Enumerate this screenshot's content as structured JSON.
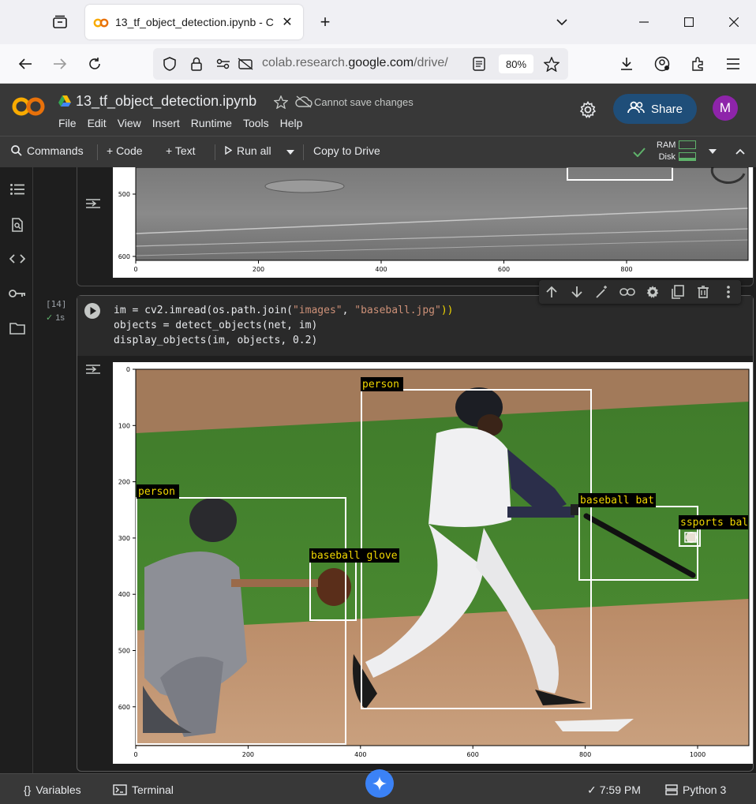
{
  "browser": {
    "tab_title": "13_tf_object_detection.ipynb - C",
    "url_host": "colab.research.google.com",
    "url_path": "/drive/",
    "url_scheme_prefix": "colab.research.",
    "zoom": "80%"
  },
  "colab": {
    "notebook_title": "13_tf_object_detection.ipynb",
    "save_status": "Cannot save changes",
    "menu": [
      "File",
      "Edit",
      "View",
      "Insert",
      "Runtime",
      "Tools",
      "Help"
    ],
    "share_label": "Share",
    "avatar_letter": "M",
    "toolbar": {
      "commands": "Commands",
      "code": "+ Code",
      "text": "+ Text",
      "run_all": "Run all",
      "copy_to_drive": "Copy to Drive",
      "ram": "RAM",
      "disk": "Disk"
    }
  },
  "prev_output": {
    "y_ticks": [
      "500",
      "600"
    ],
    "x_ticks": [
      "0",
      "200",
      "400",
      "600",
      "800"
    ]
  },
  "cell": {
    "exec_count": "[14]",
    "exec_time": "1s",
    "code_lines": [
      {
        "a": "im = cv2.imread(os.path.join(",
        "s1": "\"images\"",
        "b": ", ",
        "s2": "\"baseball.jpg\"",
        "c": "))"
      },
      {
        "a": "objects = detect_objects(net, im)"
      },
      {
        "a": "display_objects(im, objects, 0.2)"
      }
    ]
  },
  "output_plot": {
    "y_ticks": [
      "0",
      "100",
      "200",
      "300",
      "400",
      "500",
      "600"
    ],
    "x_ticks": [
      "0",
      "200",
      "400",
      "600",
      "800",
      "1000"
    ],
    "detections": [
      {
        "label": "person"
      },
      {
        "label": "person"
      },
      {
        "label": "baseball glove"
      },
      {
        "label": "baseball bat"
      },
      {
        "label": "sports bal"
      }
    ]
  },
  "status_bar": {
    "variables": "Variables",
    "terminal": "Terminal",
    "time": "7:59 PM",
    "runtime": "Python 3"
  },
  "colors": {
    "accent_share": "#1f4e79",
    "avatar": "#8e24aa",
    "label_text": "#f1d700",
    "box": "#ffffff"
  }
}
